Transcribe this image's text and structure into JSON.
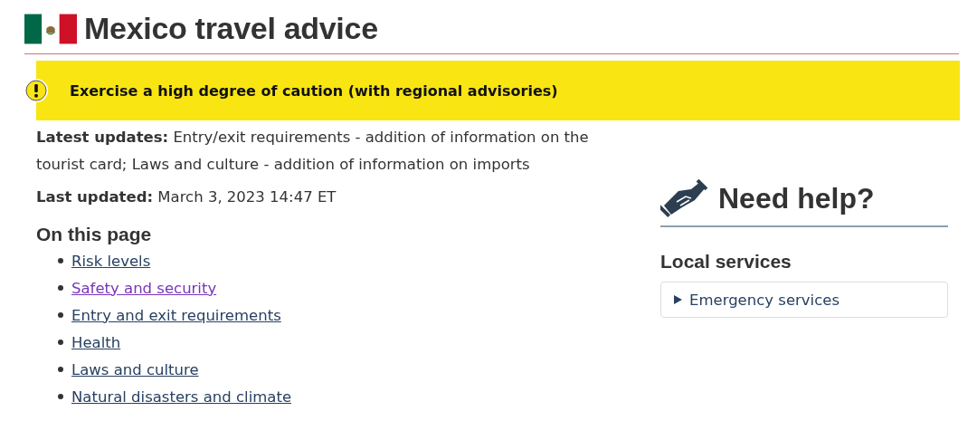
{
  "title": "Mexico travel advice",
  "advisory": {
    "color": "#f9e512",
    "text": "Exercise a high degree of caution (with regional advisories)"
  },
  "latest_updates": {
    "label": "Latest updates:",
    "text": "Entry/exit requirements - addition of information on the tourist card; Laws and culture - addition of information on imports"
  },
  "last_updated": {
    "label": "Last updated:",
    "text": "March 3, 2023 14:47 ET"
  },
  "on_this_page": {
    "heading": "On this page",
    "links": [
      {
        "label": "Risk levels",
        "visited": false
      },
      {
        "label": "Safety and security",
        "visited": true
      },
      {
        "label": "Entry and exit requirements",
        "visited": false
      },
      {
        "label": "Health",
        "visited": false
      },
      {
        "label": "Laws and culture",
        "visited": false
      },
      {
        "label": "Natural disasters and climate",
        "visited": false
      }
    ]
  },
  "help": {
    "heading": "Need help?",
    "section": "Local services",
    "items": [
      {
        "label": "Emergency services",
        "expanded": false
      }
    ]
  }
}
